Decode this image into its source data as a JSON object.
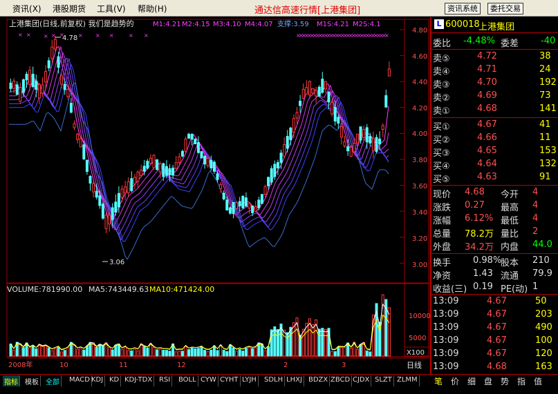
{
  "menu": {
    "items": [
      "资讯",
      "港股期货",
      "工具",
      "帮助"
    ],
    "hotkeys": [
      "(X)",
      "",
      "(V)",
      "(H)"
    ],
    "title": "通达信高速行情",
    "title_group": "[上港集团]",
    "btn_news": "资讯系统",
    "btn_trade": "委托交易"
  },
  "chart": {
    "header": "上港集团(日线,前复权) 我们是趋势的",
    "ma_labels": [
      "M1:4.21",
      "M2:4.15",
      "M3:4.10",
      "M4:4.07"
    ],
    "support": "支撑:3.59",
    "ma_labels2": [
      "M1S:4.21",
      "M2S:4.1"
    ],
    "annot_high": "4.78",
    "annot_low": "3.06",
    "yticks": [
      "4.80",
      "4.60",
      "4.40",
      "4.20",
      "4.00",
      "3.80",
      "3.60",
      "3.40",
      "3.20",
      "3.00"
    ],
    "volume_header": [
      "VOLUME:781990.00",
      "MA5:743449.63",
      "MA10:471424.00"
    ],
    "vol_yticks": [
      "10000",
      "5000"
    ],
    "vol_unit": "X100",
    "xlabels": [
      "2008年",
      "10",
      "11",
      "12",
      "2",
      "3"
    ],
    "period": "日线",
    "colors": {
      "up": "#ff3a3a",
      "down": "#54ffff",
      "ma": "#ff00ff",
      "support": "#3a6ccf",
      "vol_ma5": "#ffffff",
      "vol_ma10": "#ffff00"
    }
  },
  "quote": {
    "code": "600018",
    "name": "上港集团",
    "wb_label": "委比",
    "wb": "-4.48%",
    "wc_label": "委差",
    "wc": "-40",
    "sell": [
      {
        "label": "卖⑤",
        "price": "4.72",
        "vol": "38"
      },
      {
        "label": "卖④",
        "price": "4.71",
        "vol": "24"
      },
      {
        "label": "卖③",
        "price": "4.70",
        "vol": "192"
      },
      {
        "label": "卖②",
        "price": "4.69",
        "vol": "73"
      },
      {
        "label": "卖①",
        "price": "4.68",
        "vol": "141"
      }
    ],
    "buy": [
      {
        "label": "买①",
        "price": "4.67",
        "vol": "41"
      },
      {
        "label": "买②",
        "price": "4.66",
        "vol": "11"
      },
      {
        "label": "买③",
        "price": "4.65",
        "vol": "153"
      },
      {
        "label": "买④",
        "price": "4.64",
        "vol": "132"
      },
      {
        "label": "买⑤",
        "price": "4.63",
        "vol": "91"
      }
    ],
    "stats": [
      {
        "l1": "现价",
        "v1": "4.68",
        "l2": "今开",
        "v2": "4"
      },
      {
        "l1": "涨跌",
        "v1": "0.27",
        "l2": "最高",
        "v2": "4"
      },
      {
        "l1": "涨幅",
        "v1": "6.12%",
        "l2": "最低",
        "v2": "4"
      },
      {
        "l1": "总量",
        "v1": "78.2万",
        "l2": "量比",
        "v2": "2"
      },
      {
        "l1": "外盘",
        "v1": "34.2万",
        "l2": "内盘",
        "v2": "44.0"
      }
    ],
    "fin": [
      {
        "l1": "换手",
        "v1": "0.98%",
        "l2": "股本",
        "v2": "210"
      },
      {
        "l1": "净资",
        "v1": "1.43",
        "l2": "流通",
        "v2": "79.9"
      },
      {
        "l1": "收益(三)",
        "v1": "0.19",
        "l2": "PE(动)",
        "v2": "1"
      }
    ],
    "ticks": [
      {
        "t": "13:09",
        "p": "4.67",
        "v": "50"
      },
      {
        "t": "13:09",
        "p": "4.67",
        "v": "203"
      },
      {
        "t": "13:09",
        "p": "4.67",
        "v": "490"
      },
      {
        "t": "13:09",
        "p": "4.67",
        "v": "100"
      },
      {
        "t": "13:09",
        "p": "4.67",
        "v": "120"
      },
      {
        "t": "13:09",
        "p": "4.68",
        "v": "163"
      }
    ]
  },
  "bottom": {
    "tabs": [
      "指标",
      "模板",
      "全部",
      "MACD",
      "KDJ",
      "KD",
      "KDJ-TDX",
      "RSI",
      "BOLL",
      "CYW",
      "CYHT",
      "LYJH",
      "SDLH",
      "LHXJ",
      "BDZX",
      "ZBCD",
      "CJDX",
      "SLZT",
      "ZLMM"
    ],
    "right_tabs": [
      "笔",
      "价",
      "细",
      "盘",
      "势",
      "指",
      "值"
    ]
  }
}
